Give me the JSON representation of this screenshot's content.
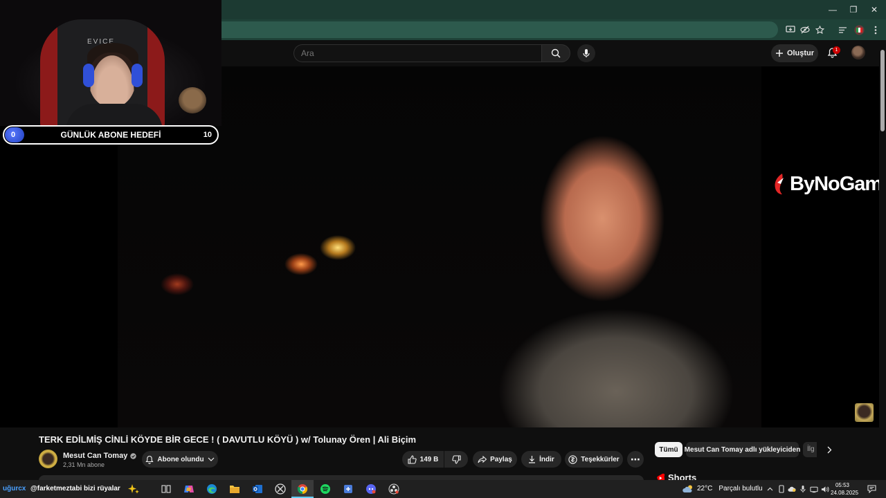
{
  "browser": {
    "window_controls": {
      "minimize": "—",
      "restore": "❐",
      "close": "✕"
    }
  },
  "header": {
    "search_placeholder": "Ara",
    "create_label": "Oluştur",
    "notification_count": "1"
  },
  "overlay": {
    "goal": {
      "start": "0",
      "label": "GÜNLÜK ABONE HEDEFİ",
      "end": "10",
      "progress": 0
    },
    "chair_brand": "EVICE"
  },
  "video": {
    "sponsor_logo": "ByNoGame",
    "title": "TERK EDİLMİŞ CİNLİ KÖYDE BİR GECE ! ( DAVUTLU KÖYÜ ) w/ Tolunay Ören | Ali Biçim"
  },
  "channel": {
    "name": "Mesut Can Tomay",
    "subscribers": "2,31 Mn abone",
    "subscribe_label": "Abone olundu"
  },
  "actions": {
    "likes": "149 B",
    "share": "Paylaş",
    "download": "İndir",
    "thanks": "Teşekkürler",
    "more": "⋯"
  },
  "sidebar": {
    "chips": [
      "Tümü",
      "Mesut Can Tomay adlı yükleyiciden",
      "İlg"
    ],
    "shorts_title": "Shorts"
  },
  "taskbar": {
    "start_text": "uğurcx",
    "song": "@farketmeztabi bizi rüyalar",
    "temperature": "22°C",
    "weather": "Parçalı bulutlu",
    "time": "05:53",
    "date": "24.08.2025"
  },
  "colors": {
    "accent_blue": "#3ea6ff",
    "youtube_red": "#cc0000",
    "chrome_green": "#1c3a32",
    "goal_blue": "#3050d8"
  }
}
